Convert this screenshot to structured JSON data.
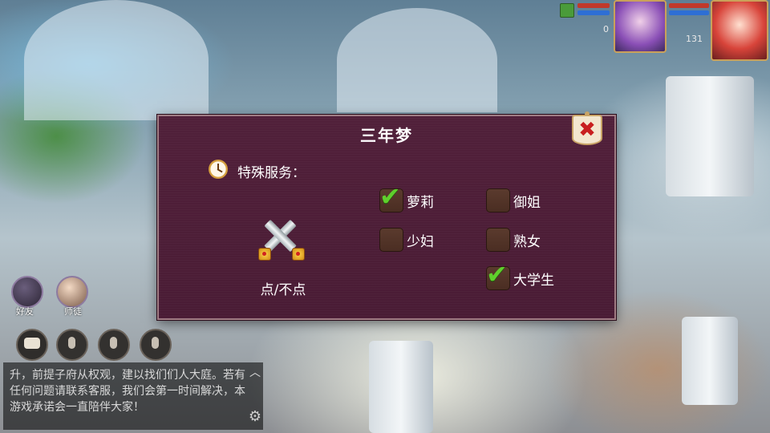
{
  "hud": {
    "player_levels": [
      "0",
      "131"
    ]
  },
  "side_buttons": {
    "friends_label": "好友",
    "mentor_label": "师徒"
  },
  "chat": {
    "text": "升，前提子府从权观，建以找们们人大庭。若有任何问题请联系客服，我们会第一时间解决，本游戏承诺会一直陪伴大家！"
  },
  "dialog": {
    "title": "三年梦",
    "service_label": "特殊服务：",
    "toggle_label": "点/不点",
    "options": [
      {
        "label": "萝莉",
        "checked": true
      },
      {
        "label": "御姐",
        "checked": false
      },
      {
        "label": "少妇",
        "checked": false
      },
      {
        "label": "熟女",
        "checked": false
      },
      {
        "label": "大学生",
        "checked": true
      }
    ]
  },
  "icons": {
    "close": "close-icon",
    "clock": "clock-icon",
    "swords": "crossed-swords-icon",
    "check": "checkmark-icon",
    "mic": "microphone-icon",
    "chat": "chat-bubble-icon",
    "settings": "gear-icon"
  },
  "colors": {
    "dialog_bg": "#4d1e37",
    "dialog_border": "#a07c84",
    "check_green": "#5fcf2c",
    "close_red": "#c81f1f"
  }
}
